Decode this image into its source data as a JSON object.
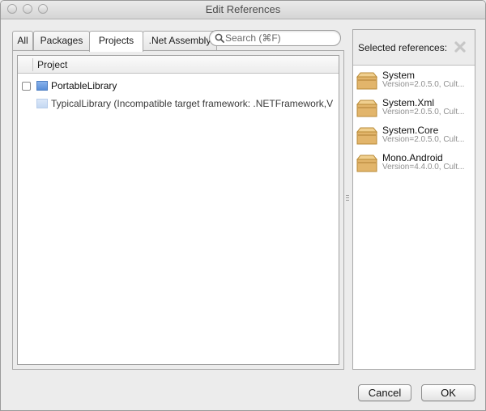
{
  "window": {
    "title": "Edit References"
  },
  "tabs": [
    {
      "label": "All"
    },
    {
      "label": "Packages"
    },
    {
      "label": "Projects"
    },
    {
      "label": ".Net Assembly"
    }
  ],
  "active_tab": "Projects",
  "search": {
    "placeholder": "Search (⌘F)",
    "value": ""
  },
  "project_list": {
    "column_header": "Project",
    "rows": [
      {
        "label": "PortableLibrary",
        "checked": false,
        "enabled": true
      },
      {
        "label": "TypicalLibrary (Incompatible target framework: .NETFramework,V",
        "enabled": false
      }
    ]
  },
  "selected_references": {
    "title": "Selected references:",
    "items": [
      {
        "name": "System",
        "version": "Version=2.0.5.0, Cult..."
      },
      {
        "name": "System.Xml",
        "version": "Version=2.0.5.0, Cult..."
      },
      {
        "name": "System.Core",
        "version": "Version=2.0.5.0, Cult..."
      },
      {
        "name": "Mono.Android",
        "version": "Version=4.4.0.0, Cult..."
      }
    ]
  },
  "buttons": {
    "cancel": "Cancel",
    "ok": "OK"
  },
  "colors": {
    "window_bg": "#ececec",
    "project_icon": "#5a8fd8",
    "package_icon": "#e2b56b"
  }
}
